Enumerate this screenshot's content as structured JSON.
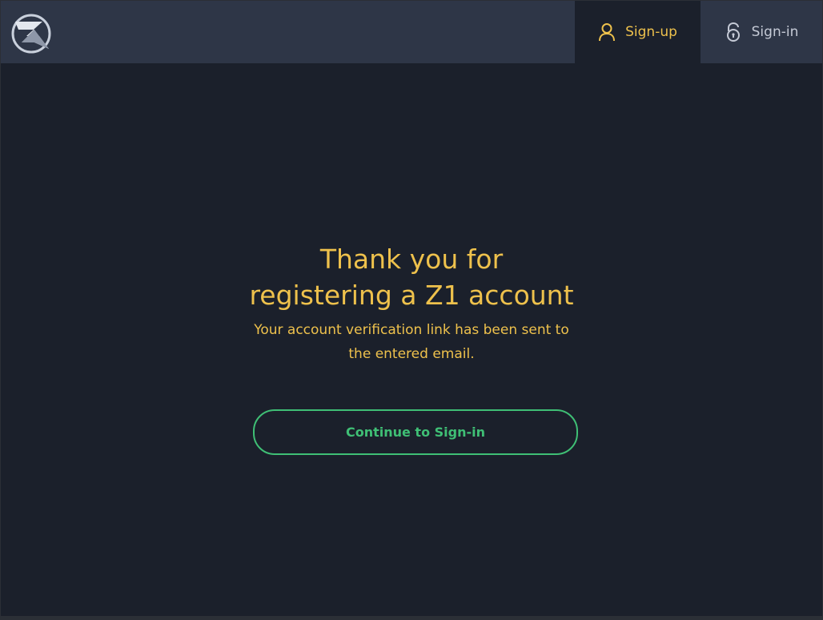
{
  "header": {
    "nav": {
      "signup_label": "Sign-up",
      "signin_label": "Sign-in",
      "active_tab": "signup"
    }
  },
  "main": {
    "title_line1": "Thank you for",
    "title_line2": "registering a Z1 account",
    "message_line1": "Your account verification link has been sent to",
    "message_line2": "the entered email.",
    "continue_label": "Continue to Sign-in"
  },
  "icons": {
    "logo": "z1-logo-icon",
    "signup": "user-icon",
    "signin": "unlock-icon"
  },
  "colors": {
    "accent_yellow": "#eec14c",
    "accent_green": "#3fbf75",
    "background": "#1b202b",
    "header_background": "#2e3647",
    "inactive_tab_text": "#c5cad6"
  }
}
